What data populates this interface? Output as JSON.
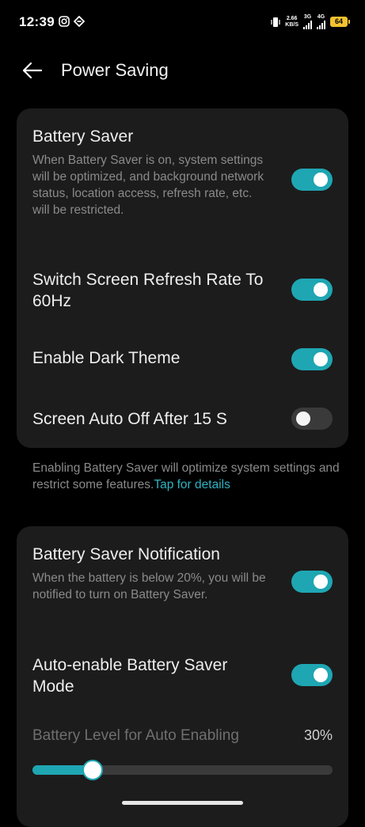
{
  "status_bar": {
    "time": "12:39",
    "speed_value": "2.66",
    "speed_unit": "KB/S",
    "net1": "3G",
    "net2": "4G",
    "battery": "64"
  },
  "header": {
    "title": "Power Saving"
  },
  "card1": {
    "battery_saver": {
      "title": "Battery Saver",
      "desc": "When Battery Saver is on, system settings will be optimized, and background network status, location access, refresh rate, etc. will be restricted.",
      "on": true
    },
    "refresh_rate": {
      "title": "Switch Screen Refresh Rate To 60Hz",
      "on": true
    },
    "dark_theme": {
      "title": "Enable Dark Theme",
      "on": true
    },
    "auto_off": {
      "title": "Screen Auto Off After 15 S",
      "on": false
    }
  },
  "note": {
    "text": "Enabling Battery Saver will optimize system settings and restrict some features.",
    "link": "Tap for details"
  },
  "card2": {
    "notification": {
      "title": "Battery Saver Notification",
      "desc": "When the battery is below 20%, you will be notified to turn on Battery Saver.",
      "on": true
    },
    "auto_enable": {
      "title": "Auto-enable Battery Saver Mode",
      "on": true
    },
    "level": {
      "label": "Battery Level for Auto Enabling",
      "value_text": "30%",
      "value_fraction": 0.2
    }
  },
  "colors": {
    "accent": "#1fa6b3",
    "card": "#1c1c1c",
    "background": "#000000"
  }
}
